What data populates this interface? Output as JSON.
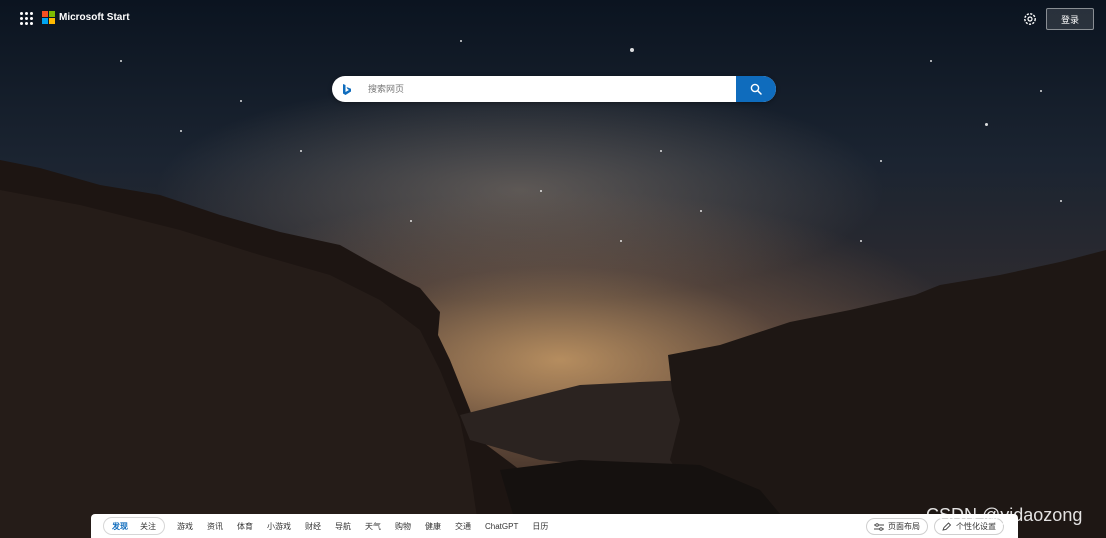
{
  "header": {
    "brand": "Microsoft Start",
    "login_label": "登录",
    "apps_icon": "apps-grid-icon",
    "settings_icon": "gear-icon"
  },
  "search": {
    "placeholder": "搜索网页",
    "submit_icon": "search-icon",
    "logo_icon": "bing-icon",
    "accent": "#0f6cbd"
  },
  "feed": {
    "tabs": [
      {
        "label": "发现",
        "active": true
      },
      {
        "label": "关注",
        "active": false
      }
    ],
    "categories": [
      "游戏",
      "资讯",
      "体育",
      "小游戏",
      "财经",
      "导航",
      "天气",
      "购物",
      "健康",
      "交通",
      "ChatGPT",
      "日历"
    ],
    "layout_label": "页面布局",
    "personalize_label": "个性化设置"
  },
  "watermark": "CSDN @yidaozong",
  "colors": {
    "ms_red": "#f25022",
    "ms_green": "#7fba00",
    "ms_blue": "#00a4ef",
    "ms_yellow": "#ffb900"
  }
}
